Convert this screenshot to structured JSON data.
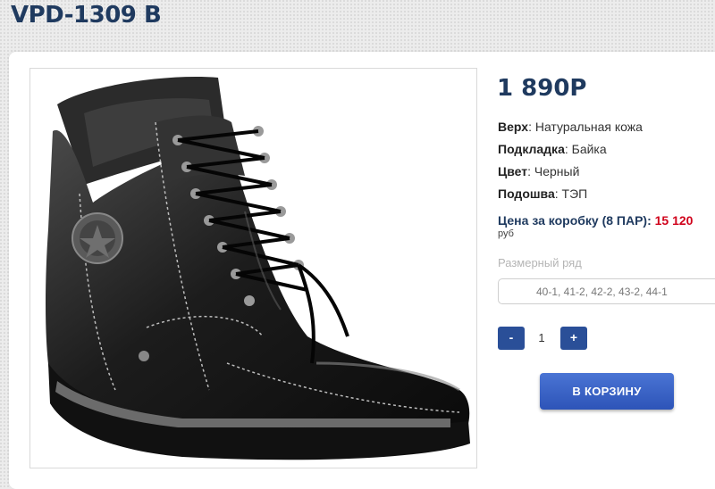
{
  "product": {
    "title": "VPD-1309 B",
    "price": "1 890Р",
    "image_alt": "black-leather-lace-up-boot",
    "specs": [
      {
        "label": "Верх",
        "value": ": Натуральная кожа"
      },
      {
        "label": "Подкладка",
        "value": ": Байка"
      },
      {
        "label": "Цвет",
        "value": ": Черный"
      },
      {
        "label": "Подошва",
        "value": ": ТЭП"
      }
    ],
    "box_price": {
      "label": "Цена за коробку (8 ПАР): ",
      "amount": "15 120",
      "unit": "руб"
    },
    "size_range": {
      "label": "Размерный ряд",
      "value": "40-1, 41-2, 42-2, 43-2, 44-1"
    },
    "quantity": {
      "minus": "-",
      "value": "1",
      "plus": "+"
    },
    "cart_button": "В КОРЗИНУ"
  },
  "colors": {
    "title": "#1f3a5f",
    "accent": "#2a4f98",
    "box_amount": "#d0021b"
  }
}
